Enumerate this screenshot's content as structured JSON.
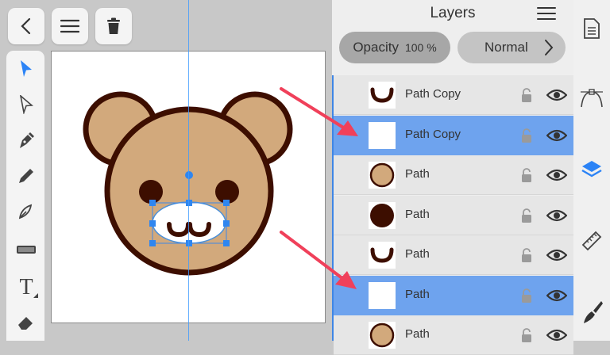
{
  "toolbar": {
    "back_icon": "chevron-left-icon",
    "menu_icon": "hamburger-icon",
    "delete_icon": "trash-icon"
  },
  "tools": [
    "move-tool",
    "node-tool",
    "pen-tool",
    "pencil-tool",
    "vector-brush-tool",
    "fill-tool",
    "text-tool",
    "eraser-tool"
  ],
  "text_tool_label": "T",
  "panel": {
    "title": "Layers",
    "opacity_label": "Opacity",
    "opacity_value": "100 %",
    "blend_mode": "Normal"
  },
  "layers": [
    {
      "name": "Path Copy",
      "thumb": "smile",
      "selected": false
    },
    {
      "name": "Path Copy",
      "thumb": "white",
      "selected": true
    },
    {
      "name": "Path",
      "thumb": "tan-circle",
      "selected": false
    },
    {
      "name": "Path",
      "thumb": "dark-circle",
      "selected": false
    },
    {
      "name": "Path",
      "thumb": "smile",
      "selected": false
    },
    {
      "name": "Path",
      "thumb": "white",
      "selected": true
    },
    {
      "name": "Path",
      "thumb": "tan-circle",
      "selected": false
    }
  ],
  "colors": {
    "accent": "#3f86e6",
    "selection_row": "#6ea3ee",
    "bear_fill": "#d2a97c",
    "bear_outline": "#3d0e00",
    "arrow": "#f0405a"
  },
  "right_icons": [
    "document-icon",
    "node-edit-icon",
    "layers-icon",
    "ruler-icon",
    "brush-icon"
  ]
}
